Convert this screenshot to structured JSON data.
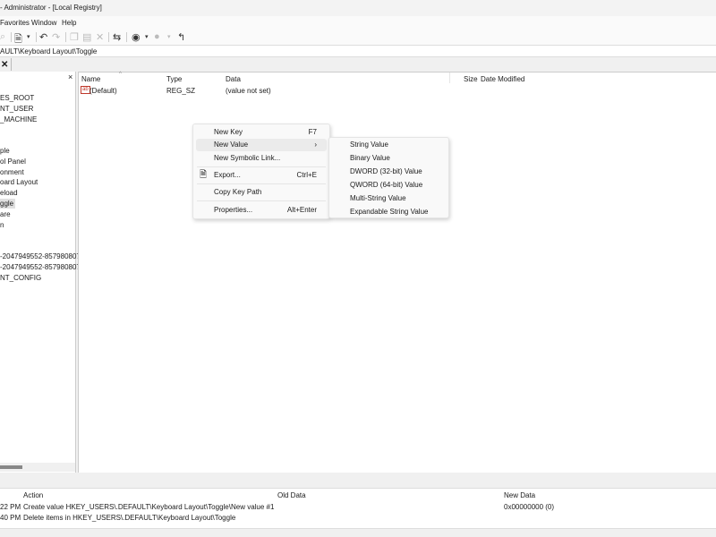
{
  "title": "- Administrator - [Local Registry]",
  "menubar": [
    "Favorites",
    "Window",
    "Help"
  ],
  "toolbar": {
    "icons": [
      "find-icon",
      "new-document-icon",
      "dropdown-arrow-icon",
      "undo-icon",
      "redo-icon",
      "copy-icon",
      "paste-icon",
      "delete-icon",
      "refresh-icon",
      "back-icon",
      "dropdown-arrow-icon",
      "forward-icon",
      "dropdown-arrow-icon",
      "parent-key-icon"
    ]
  },
  "address": "AULT\\Keyboard Layout\\Toggle",
  "tree": {
    "close": "×",
    "items": [
      "ES_ROOT",
      "NT_USER",
      "_MACHINE",
      "",
      "",
      "ple",
      "ol Panel",
      "onment",
      "oard Layout",
      "eload",
      "ggle",
      "are",
      "n",
      "",
      "",
      "-2047949552-857980807",
      "-2047949552-857980807",
      "NT_CONFIG"
    ],
    "selected_index": 10
  },
  "list": {
    "columns": [
      "Name",
      "Type",
      "Data",
      "Size",
      "Date Modified"
    ],
    "rows": [
      {
        "name": "(Default)",
        "type": "REG_SZ",
        "data": "(value not set)",
        "size": "",
        "date": ""
      }
    ]
  },
  "context_menu": {
    "items": [
      {
        "label": "New Key",
        "shortcut": "F7"
      },
      {
        "label": "New Value",
        "shortcut": "›"
      },
      {
        "label": "New Symbolic Link..."
      },
      {
        "label": "Export...",
        "shortcut": "Ctrl+E"
      },
      {
        "label": "Copy Key Path"
      },
      {
        "label": "Properties...",
        "shortcut": "Alt+Enter"
      }
    ]
  },
  "submenu": [
    "String Value",
    "Binary Value",
    "DWORD (32-bit) Value",
    "QWORD (64-bit) Value",
    "Multi-String Value",
    "Expandable String Value"
  ],
  "history": {
    "columns": [
      "Action",
      "Old Data",
      "New Data"
    ],
    "rows": [
      {
        "time": "22 PM",
        "action": "Create value HKEY_USERS\\.DEFAULT\\Keyboard Layout\\Toggle\\New value #1",
        "old": "",
        "new": "0x00000000 (0)"
      },
      {
        "time": "40 PM",
        "action": "Delete items in HKEY_USERS\\.DEFAULT\\Keyboard Layout\\Toggle",
        "old": "",
        "new": ""
      }
    ]
  },
  "tab_close": "✕"
}
